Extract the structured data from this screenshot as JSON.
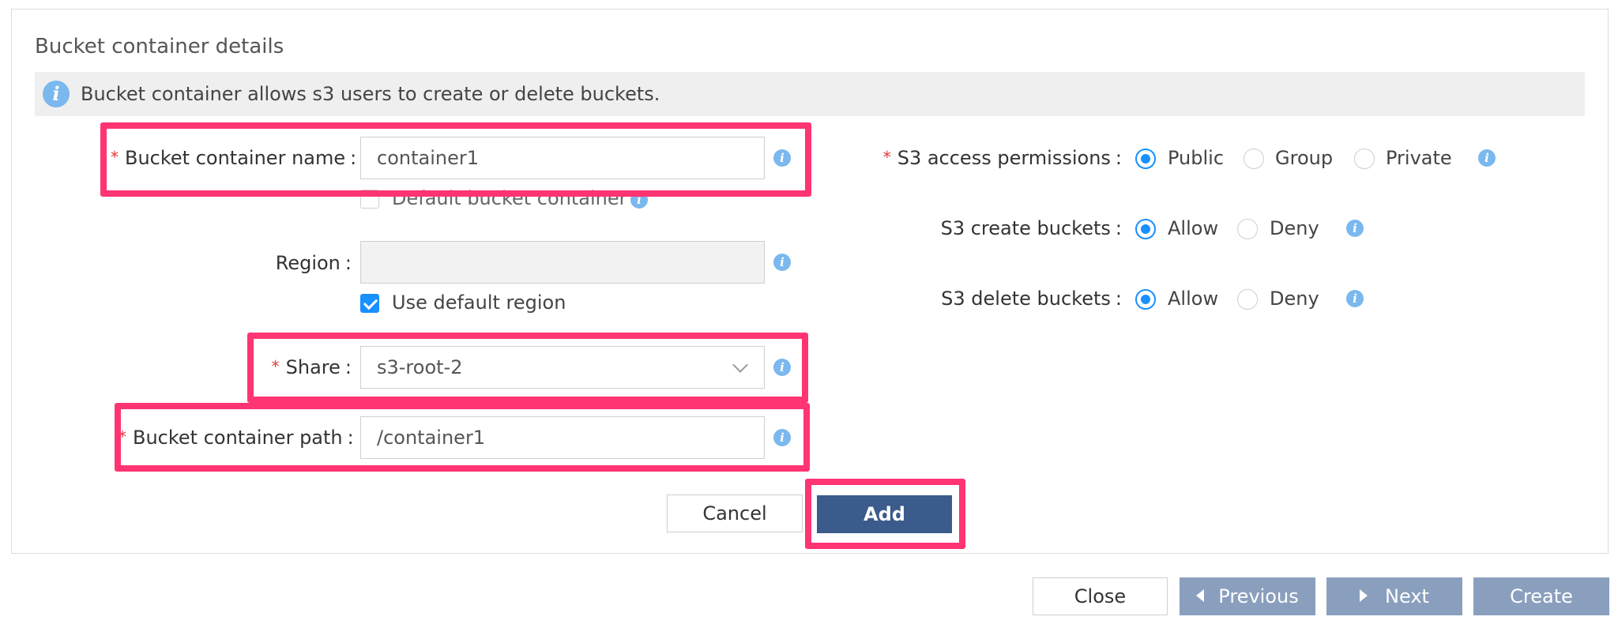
{
  "section": {
    "title": "Bucket container details",
    "banner_text": "Bucket container allows s3 users to create or delete buckets.",
    "banner_icon": "info-icon"
  },
  "form": {
    "name": {
      "label": "Bucket container name",
      "colon": ":",
      "value": "container1",
      "required": true
    },
    "default_container": {
      "label": "Default bucket container",
      "checked": false
    },
    "region": {
      "label": "Region",
      "colon": ":",
      "value": ""
    },
    "use_default_region": {
      "label": "Use default region",
      "checked": true
    },
    "share": {
      "label": "Share",
      "colon": ":",
      "value": "s3-root-2",
      "required": true
    },
    "path": {
      "label": "Bucket container path",
      "colon": ":",
      "value": "/container1",
      "required": true
    },
    "cancel_label": "Cancel",
    "add_label": "Add"
  },
  "permissions": {
    "access": {
      "label": "S3 access permissions",
      "colon": ":",
      "required": true,
      "options": [
        "Public",
        "Group",
        "Private"
      ],
      "selected": "Public"
    },
    "create": {
      "label": "S3 create buckets",
      "colon": ":",
      "options": [
        "Allow",
        "Deny"
      ],
      "selected": "Allow"
    },
    "delete": {
      "label": "S3 delete buckets",
      "colon": ":",
      "options": [
        "Allow",
        "Deny"
      ],
      "selected": "Allow"
    }
  },
  "footer": {
    "close_label": "Close",
    "previous_label": "Previous",
    "next_label": "Next",
    "create_label": "Create"
  },
  "colors": {
    "highlight": "#ff3472",
    "primary": "#3a5b8c",
    "accent": "#1890ff",
    "info": "#7ab8ee",
    "required": "#e53838"
  }
}
